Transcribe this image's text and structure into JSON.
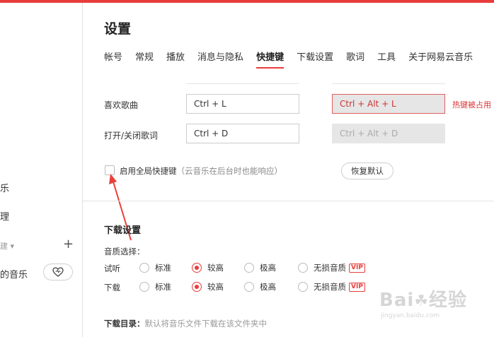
{
  "sidebar": {
    "items": [
      {
        "label": "乐"
      },
      {
        "label": "理"
      },
      {
        "label": "建"
      },
      {
        "label": "的音乐"
      }
    ]
  },
  "settings": {
    "title": "设置",
    "tabs": [
      {
        "label": "帐号"
      },
      {
        "label": "常规"
      },
      {
        "label": "播放"
      },
      {
        "label": "消息与隐私"
      },
      {
        "label": "快捷键",
        "active": true
      },
      {
        "label": "下载设置"
      },
      {
        "label": "歌词"
      },
      {
        "label": "工具"
      },
      {
        "label": "关于网易云音乐"
      }
    ]
  },
  "shortcuts": {
    "rows": [
      {
        "label": "喜欢歌曲",
        "local": "Ctrl + L",
        "global": "Ctrl + Alt + L",
        "conflict": "热键被占用"
      },
      {
        "label": "打开/关闭歌词",
        "local": "Ctrl + D",
        "global": "Ctrl + Alt + D"
      }
    ],
    "enable_global_label": "启用全局快捷键",
    "enable_global_hint": "（云音乐在后台时也能响应）",
    "restore_label": "恢复默认"
  },
  "download": {
    "title": "下载设置",
    "quality_label": "音质选择：",
    "rows": [
      {
        "label": "试听",
        "options": [
          "标准",
          "较高",
          "极高",
          "无损音质"
        ],
        "selected": 1
      },
      {
        "label": "下载",
        "options": [
          "标准",
          "较高",
          "极高",
          "无损音质"
        ],
        "selected": 1
      }
    ],
    "vip_badge": "VIP",
    "dir_label": "下载目录：",
    "dir_hint": "默认将音乐文件下载在该文件夹中"
  },
  "watermark": {
    "main": "Bai du 经验",
    "sub": "jingyan.baidu.com"
  },
  "colors": {
    "accent": "#e83c3c",
    "annotation_arrow": "#e8413c"
  }
}
